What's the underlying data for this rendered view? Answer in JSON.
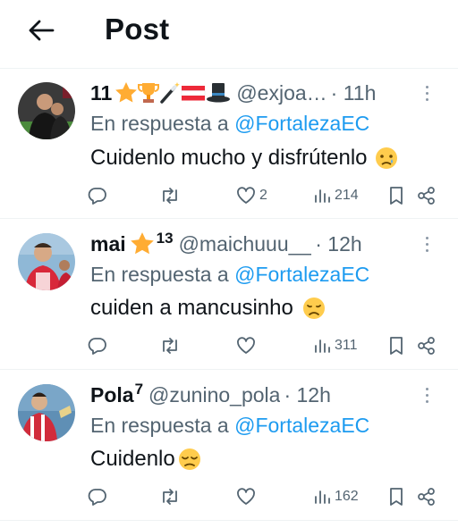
{
  "header": {
    "title": "Post"
  },
  "tweets": [
    {
      "name": "11",
      "handle": "@exjoa…",
      "time": "· 11h",
      "reply_prefix": "En respuesta a",
      "reply_mention": "@FortalezaEC",
      "text": "Cuidenlo mucho y disfrútenlo",
      "likes": "2",
      "views": "214",
      "badges": [
        "star-emoji",
        "trophy-emoji",
        "magic-wand-emoji",
        "austria-flag-emoji",
        "top-hat-emoji"
      ],
      "text_emoji": "crying-face-emoji"
    },
    {
      "name": "mai",
      "name_superscript": "13",
      "handle": "@maichuuu__",
      "time": "· 12h",
      "reply_prefix": "En respuesta a",
      "reply_mention": "@FortalezaEC",
      "text": "cuiden a mancusinho",
      "likes": "",
      "views": "311",
      "badges": [
        "star-emoji"
      ],
      "text_emoji": "disappointed-face-emoji"
    },
    {
      "name": "Pola",
      "name_superscript": "7",
      "handle": "@zunino_pola",
      "time": "· 12h",
      "reply_prefix": "En respuesta a",
      "reply_mention": "@FortalezaEC",
      "text": "Cuidenlo",
      "likes": "",
      "views": "162",
      "badges": [],
      "text_emoji": "pensive-face-emoji"
    }
  ],
  "colors": {
    "text": "#0f1419",
    "secondary": "#536471",
    "link": "#1d9bf0",
    "divider": "#eff3f4"
  }
}
